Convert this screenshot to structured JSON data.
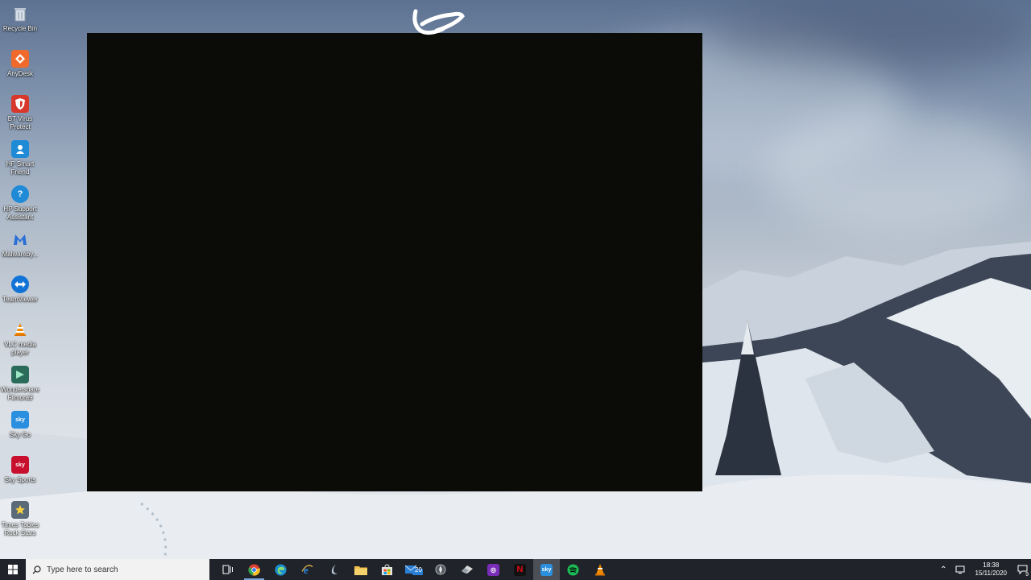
{
  "desktop": {
    "icons": [
      {
        "label": "Recycle Bin",
        "icon": "recycle-bin-icon",
        "color": "#c8d4e0"
      },
      {
        "label": "AnyDesk",
        "icon": "anydesk-icon",
        "color": "#ef6a2b"
      },
      {
        "label": "BT Virus Protect",
        "icon": "bt-virus-protect-icon",
        "color": "#d8372c"
      },
      {
        "label": "HP Smart Friend",
        "icon": "hp-smart-friend-icon",
        "color": "#1f8ad6"
      },
      {
        "label": "HP Support Assistant",
        "icon": "hp-support-assistant-icon",
        "color": "#1f8ad6"
      },
      {
        "label": "Malwareby...",
        "icon": "malwarebytes-icon",
        "color": "#2a6fd6"
      },
      {
        "label": "TeamViewer",
        "icon": "teamviewer-icon",
        "color": "#1273d6"
      },
      {
        "label": "VLC media player",
        "icon": "vlc-icon",
        "color": "#f08a00"
      },
      {
        "label": "Wondershare Filmora9",
        "icon": "filmora-icon",
        "color": "#2a6b5a"
      },
      {
        "label": "Sky Go",
        "icon": "sky-go-icon",
        "color": "#2b8fe0"
      },
      {
        "label": "Sky Sports",
        "icon": "sky-sports-icon",
        "color": "#c8102e"
      },
      {
        "label": "Times Tables Rock Stars",
        "icon": "times-tables-rock-stars-icon",
        "color": "#5b6a78"
      }
    ]
  },
  "taskbar": {
    "search_placeholder": "Type here to search",
    "pinned": [
      {
        "name": "task-view",
        "icon": "task-view-icon",
        "color": "#202329"
      },
      {
        "name": "chrome",
        "icon": "chrome-icon",
        "color": "#e34133",
        "active": true
      },
      {
        "name": "edge",
        "icon": "edge-icon",
        "color": "#1d8fd0"
      },
      {
        "name": "internet-explorer",
        "icon": "internet-explorer-icon",
        "color": "#2d8ae5"
      },
      {
        "name": "cortana",
        "icon": "cortana-icon",
        "color": "#8fa9c9"
      },
      {
        "name": "file-explorer",
        "icon": "file-explorer-icon",
        "color": "#f3c14b"
      },
      {
        "name": "store",
        "icon": "store-icon",
        "color": "#e6e6e6"
      },
      {
        "name": "mail",
        "icon": "mail-icon",
        "color": "#2b7fd4",
        "badge": "20"
      },
      {
        "name": "app-compass",
        "icon": "compass-icon",
        "color": "#6f747b"
      },
      {
        "name": "app-eraser",
        "icon": "eraser-icon",
        "color": "#d9d9d9"
      },
      {
        "name": "app-purple",
        "icon": "purple-app-icon",
        "color": "#7a2db8"
      },
      {
        "name": "netflix",
        "icon": "netflix-icon",
        "color": "#111111"
      },
      {
        "name": "sky",
        "icon": "sky-icon",
        "color": "#2b8fe0",
        "highlight": true
      },
      {
        "name": "spotify",
        "icon": "spotify-icon",
        "color": "#1db954"
      },
      {
        "name": "vlc",
        "icon": "vlc-icon",
        "color": "#f08a00"
      }
    ],
    "clock_time": "18:38",
    "clock_date": "15/11/2020",
    "notification_count": "9"
  }
}
